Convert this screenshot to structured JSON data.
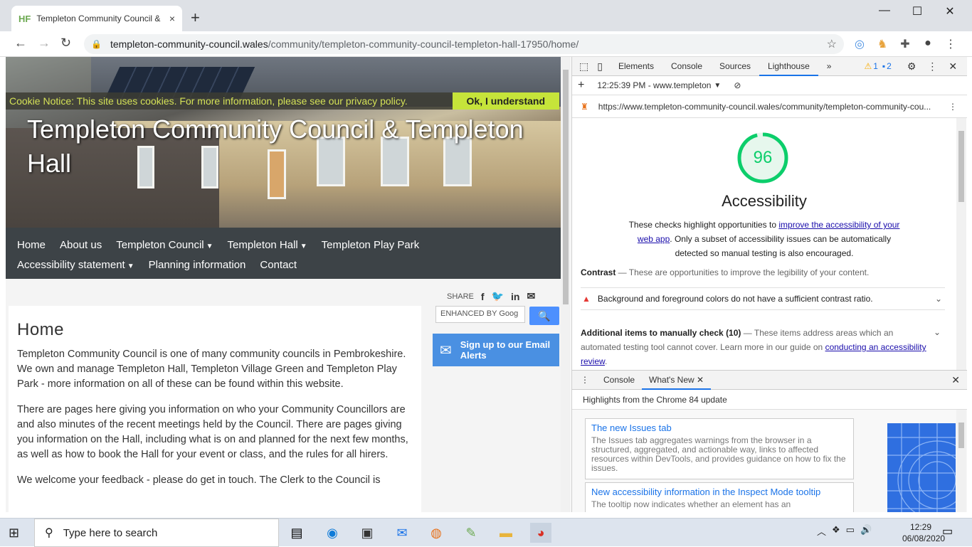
{
  "browser": {
    "tab_favicon": "HF",
    "tab_title": "Templeton Community Council &",
    "tab_close": "×",
    "new_tab": "+",
    "url_host": "templeton-community-council.wales",
    "url_path": "/community/templeton-community-council-templeton-hall-17950/home/",
    "window_controls": [
      "—",
      "☐",
      "✕"
    ]
  },
  "site": {
    "cookie_text": "Cookie Notice: This site uses cookies. For more information, please see our privacy policy.",
    "cookie_button": "Ok, I understand",
    "title": "Templeton Community Council & Templeton Hall",
    "nav_row1": [
      {
        "label": "Home",
        "caret": false
      },
      {
        "label": "About us",
        "caret": false
      },
      {
        "label": "Templeton Council",
        "caret": true
      },
      {
        "label": "Templeton Hall",
        "caret": true
      },
      {
        "label": "Templeton Play Park",
        "caret": false
      }
    ],
    "nav_row2": [
      {
        "label": "Accessibility statement",
        "caret": true
      },
      {
        "label": "Planning information",
        "caret": false
      },
      {
        "label": "Contact",
        "caret": false
      }
    ],
    "share_label": "SHARE",
    "search_placeholder": "ENHANCED BY Goog",
    "email_signup": "Sign up to our Email Alerts",
    "heading": "Home",
    "paragraphs": [
      "Templeton Community Council is one of many community councils in Pembrokeshire. We own and manage Templeton Hall, Templeton Village Green and Templeton Play Park - more information on all of these can be found within this website.",
      "There are pages here giving you information on who your Community Councillors are and also minutes of the recent meetings held by the Council. There are pages giving you information on the Hall, including what is on and planned for the next few months, as well as how to book the Hall for your event or class, and the rules for all hirers.",
      "We welcome your feedback - please do get in touch. The Clerk to the Council is"
    ]
  },
  "devtools": {
    "tabs": [
      "Elements",
      "Console",
      "Sources",
      "Lighthouse"
    ],
    "active_tab": "Lighthouse",
    "more_tabs": "»",
    "warnings_count": "1",
    "messages_count": "2",
    "report_time": "12:25:39 PM - www.templeton",
    "report_url": "https://www.templeton-community-council.wales/community/templeton-community-cou...",
    "score": "96",
    "score_fraction": 0.96,
    "score_color": "#0cce6b",
    "category_title": "Accessibility",
    "desc_before": "These checks highlight opportunities to ",
    "desc_link": "improve the accessibility of your web app",
    "desc_after": ". Only a subset of accessibility issues can be automatically detected so manual testing is also encouraged.",
    "contrast_title": "Contrast",
    "contrast_desc": " — These are opportunities to improve the legibility of your content.",
    "audit_item": "Background and foreground colors do not have a sufficient contrast ratio.",
    "manual_title": "Additional items to manually check",
    "manual_count": "(10)",
    "manual_desc": " — These items address areas which an automated testing tool cannot cover. Learn more in our guide on ",
    "manual_link": "conducting an accessibility review",
    "manual_end": ".",
    "drawer_tabs": [
      "Console",
      "What's New"
    ],
    "drawer_active": "What's New",
    "whatsnew_heading": "Highlights from the Chrome 84 update",
    "cards": [
      {
        "title": "The new Issues tab",
        "desc": "The Issues tab aggregates warnings from the browser in a structured, aggregated, and actionable way, links to affected resources within DevTools, and provides guidance on how to fix the issues."
      },
      {
        "title": "New accessibility information in the Inspect Mode tooltip",
        "desc": "The tooltip now indicates whether an element has an"
      }
    ]
  },
  "taskbar": {
    "search_text": "Type here to search",
    "time": "12:29",
    "date": "06/08/2020"
  }
}
